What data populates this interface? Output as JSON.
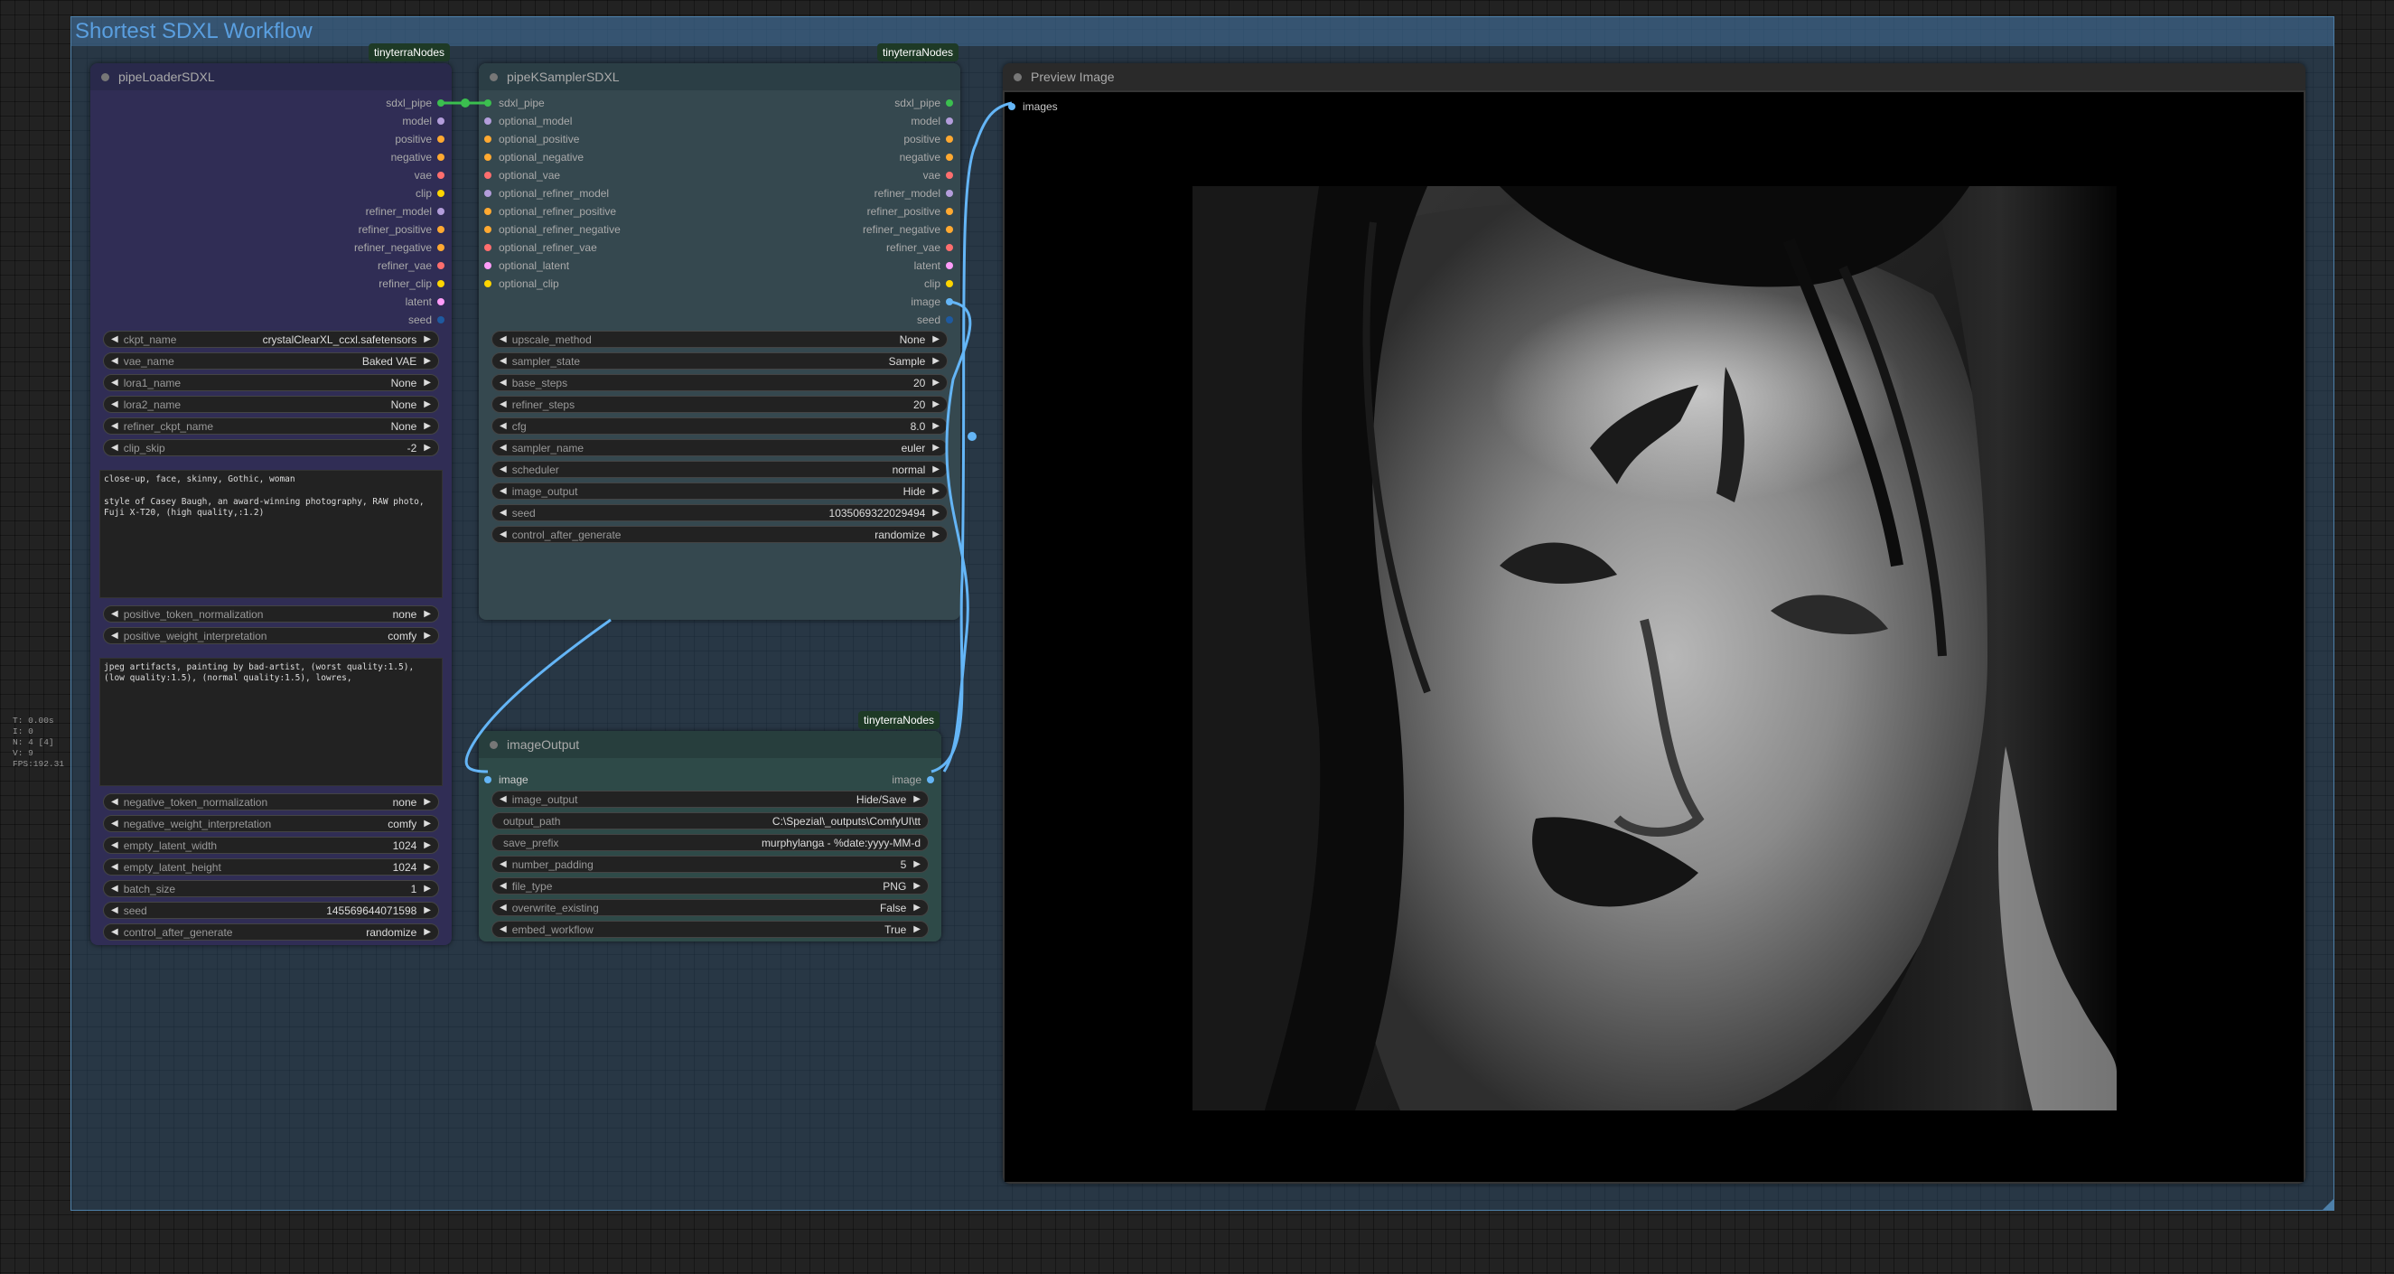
{
  "group": {
    "title": "Shortest SDXL Workflow"
  },
  "stats": [
    "T: 0.00s",
    "I: 0",
    "N: 4 [4]",
    "V: 9",
    "FPS:192.31"
  ],
  "badge": "tinyterraNodes",
  "colors": {
    "sdxl_pipe": "#3bbf4f",
    "model": "#b39ddb",
    "positive": "#ffa931",
    "negative": "#ffa931",
    "vae": "#ff6e6e",
    "clip": "#ffd500",
    "latent": "#ff9cf9",
    "seed": "#1e5aa0",
    "image": "#64b5f6",
    "wire": "#64b5f6"
  },
  "loader": {
    "title": "pipeLoaderSDXL",
    "outputs": [
      {
        "label": "sdxl_pipe",
        "color": "#3bbf4f"
      },
      {
        "label": "model",
        "color": "#b39ddb"
      },
      {
        "label": "positive",
        "color": "#ffa931"
      },
      {
        "label": "negative",
        "color": "#ffa931"
      },
      {
        "label": "vae",
        "color": "#ff6e6e"
      },
      {
        "label": "clip",
        "color": "#ffd500"
      },
      {
        "label": "refiner_model",
        "color": "#b39ddb"
      },
      {
        "label": "refiner_positive",
        "color": "#ffa931"
      },
      {
        "label": "refiner_negative",
        "color": "#ffa931"
      },
      {
        "label": "refiner_vae",
        "color": "#ff6e6e"
      },
      {
        "label": "refiner_clip",
        "color": "#ffd500"
      },
      {
        "label": "latent",
        "color": "#ff9cf9"
      },
      {
        "label": "seed",
        "color": "#1e5aa0"
      }
    ],
    "widgets_top": [
      {
        "name": "ckpt_name",
        "value": "crystalClearXL_ccxl.safetensors"
      },
      {
        "name": "vae_name",
        "value": "Baked VAE"
      },
      {
        "name": "lora1_name",
        "value": "None"
      },
      {
        "name": "lora2_name",
        "value": "None"
      },
      {
        "name": "refiner_ckpt_name",
        "value": "None"
      },
      {
        "name": "clip_skip",
        "value": "-2"
      }
    ],
    "positive_text": "close-up, face, skinny, Gothic, woman\n\nstyle of Casey Baugh, an award-winning photography, RAW photo, Fuji X-T20, (high quality,:1.2)",
    "widgets_mid": [
      {
        "name": "positive_token_normalization",
        "value": "none"
      },
      {
        "name": "positive_weight_interpretation",
        "value": "comfy"
      }
    ],
    "negative_text": "jpeg artifacts, painting by bad-artist, (worst quality:1.5), (low quality:1.5), (normal quality:1.5), lowres,",
    "widgets_bottom": [
      {
        "name": "negative_token_normalization",
        "value": "none"
      },
      {
        "name": "negative_weight_interpretation",
        "value": "comfy"
      },
      {
        "name": "empty_latent_width",
        "value": "1024"
      },
      {
        "name": "empty_latent_height",
        "value": "1024"
      },
      {
        "name": "batch_size",
        "value": "1"
      },
      {
        "name": "seed",
        "value": "145569644071598"
      },
      {
        "name": "control_after_generate",
        "value": "randomize"
      }
    ]
  },
  "sampler": {
    "title": "pipeKSamplerSDXL",
    "inputs": [
      {
        "label": "sdxl_pipe",
        "color": "#3bbf4f"
      },
      {
        "label": "optional_model",
        "color": "#b39ddb"
      },
      {
        "label": "optional_positive",
        "color": "#ffa931"
      },
      {
        "label": "optional_negative",
        "color": "#ffa931"
      },
      {
        "label": "optional_vae",
        "color": "#ff6e6e"
      },
      {
        "label": "optional_refiner_model",
        "color": "#b39ddb"
      },
      {
        "label": "optional_refiner_positive",
        "color": "#ffa931"
      },
      {
        "label": "optional_refiner_negative",
        "color": "#ffa931"
      },
      {
        "label": "optional_refiner_vae",
        "color": "#ff6e6e"
      },
      {
        "label": "optional_latent",
        "color": "#ff9cf9"
      },
      {
        "label": "optional_clip",
        "color": "#ffd500"
      }
    ],
    "outputs": [
      {
        "label": "sdxl_pipe",
        "color": "#3bbf4f"
      },
      {
        "label": "model",
        "color": "#b39ddb"
      },
      {
        "label": "positive",
        "color": "#ffa931"
      },
      {
        "label": "negative",
        "color": "#ffa931"
      },
      {
        "label": "vae",
        "color": "#ff6e6e"
      },
      {
        "label": "refiner_model",
        "color": "#b39ddb"
      },
      {
        "label": "refiner_positive",
        "color": "#ffa931"
      },
      {
        "label": "refiner_negative",
        "color": "#ffa931"
      },
      {
        "label": "refiner_vae",
        "color": "#ff6e6e"
      },
      {
        "label": "latent",
        "color": "#ff9cf9"
      },
      {
        "label": "clip",
        "color": "#ffd500"
      },
      {
        "label": "image",
        "color": "#64b5f6"
      },
      {
        "label": "seed",
        "color": "#1e5aa0"
      }
    ],
    "widgets": [
      {
        "name": "upscale_method",
        "value": "None"
      },
      {
        "name": "sampler_state",
        "value": "Sample"
      },
      {
        "name": "base_steps",
        "value": "20"
      },
      {
        "name": "refiner_steps",
        "value": "20"
      },
      {
        "name": "cfg",
        "value": "8.0"
      },
      {
        "name": "sampler_name",
        "value": "euler"
      },
      {
        "name": "scheduler",
        "value": "normal"
      },
      {
        "name": "image_output",
        "value": "Hide"
      },
      {
        "name": "seed",
        "value": "1035069322029494"
      },
      {
        "name": "control_after_generate",
        "value": "randomize"
      }
    ]
  },
  "output": {
    "title": "imageOutput",
    "input": "image",
    "output": "image",
    "widgets": [
      {
        "name": "image_output",
        "value": "Hide/Save",
        "kind": "combo"
      },
      {
        "name": "output_path",
        "value": "C:\\Spezial\\_outputs\\ComfyUI\\tt",
        "kind": "text"
      },
      {
        "name": "save_prefix",
        "value": "murphylanga - %date:yyyy-MM-d",
        "kind": "text"
      },
      {
        "name": "number_padding",
        "value": "5",
        "kind": "combo"
      },
      {
        "name": "file_type",
        "value": "PNG",
        "kind": "combo"
      },
      {
        "name": "overwrite_existing",
        "value": "False",
        "kind": "combo"
      },
      {
        "name": "embed_workflow",
        "value": "True",
        "kind": "combo"
      }
    ]
  },
  "preview": {
    "title": "Preview Image",
    "input": "images"
  }
}
